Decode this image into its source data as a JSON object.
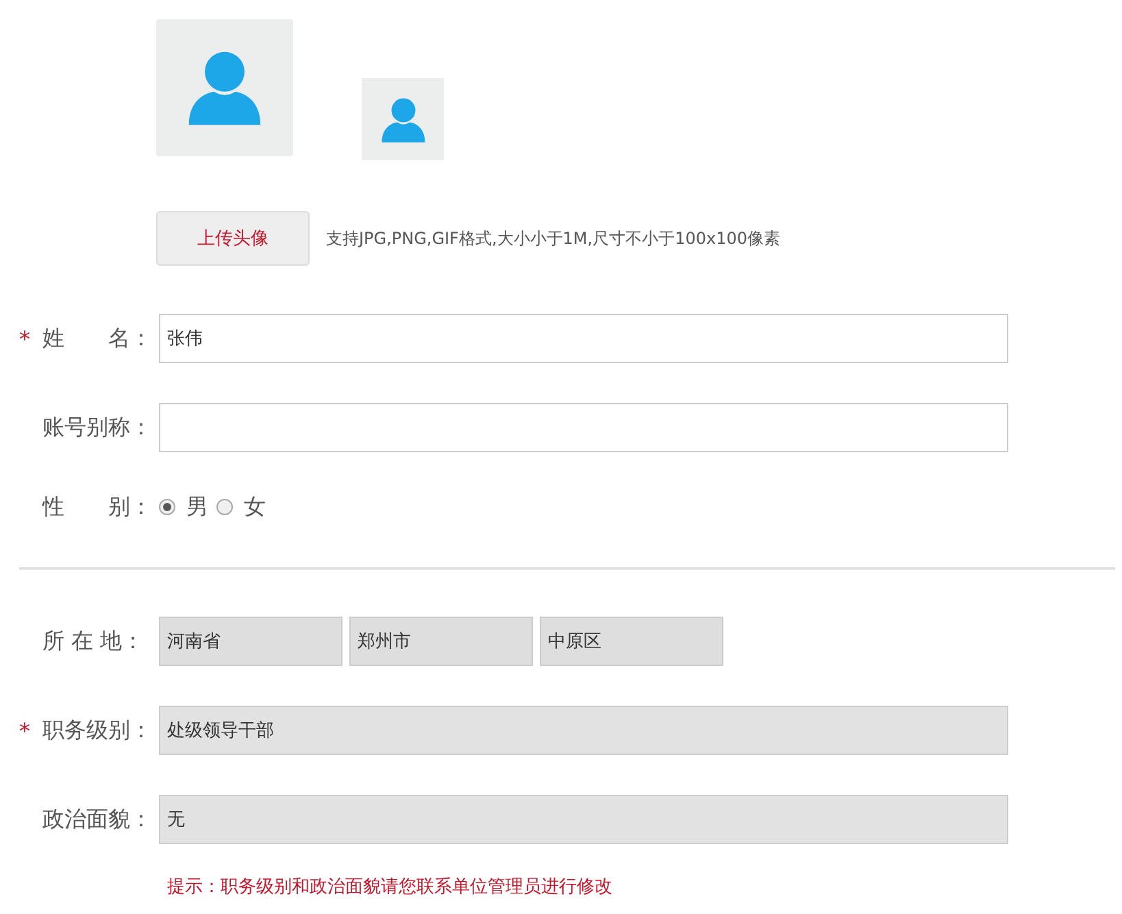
{
  "avatar": {
    "upload_button": "上传头像",
    "upload_hint": "支持JPG,PNG,GIF格式,大小小于1M,尺寸不小于100x100像素"
  },
  "sections": [
    {
      "fields": [
        {
          "kind": "text",
          "required_mark": "*",
          "label": "姓　　名：",
          "value": "张伟"
        },
        {
          "kind": "text",
          "label": "账号别称："
        },
        {
          "kind": "radio",
          "label": "性　　别：",
          "options": [
            {
              "label": "男",
              "selected": true
            },
            {
              "label": "女",
              "selected": false
            }
          ]
        }
      ]
    },
    {
      "fields": [
        {
          "kind": "location",
          "label": "所 在 地：",
          "values": [
            "河南省",
            "郑州市",
            "中原区"
          ]
        },
        {
          "kind": "readonly",
          "required_mark": "*",
          "label": "职务级别：",
          "value": "处级领导干部"
        },
        {
          "kind": "readonly",
          "label": "政治面貌：",
          "value": "无"
        }
      ]
    }
  ],
  "tip": "提示：职务级别和政治面貌请您联系单位管理员进行修改"
}
